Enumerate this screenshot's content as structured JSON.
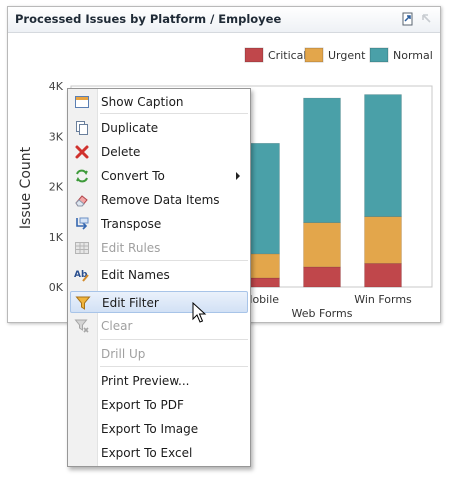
{
  "panel": {
    "title": "Processed Issues by Platform / Employee"
  },
  "chart_data": {
    "type": "bar",
    "stacked": true,
    "legend": {
      "position": "top-right",
      "entries": [
        "Critical",
        "Urgent",
        "Normal"
      ]
    },
    "colors": {
      "Critical": "#c0474b",
      "Urgent": "#e3a64b",
      "Normal": "#4aa0a8"
    },
    "ylabel": "Issue Count",
    "yticks": [
      "0K",
      "1K",
      "2K",
      "3K",
      "4K"
    ],
    "ylim": [
      0,
      4000
    ],
    "xticks": [
      "Mobile",
      "Win Forms"
    ],
    "xgroup": "Web Forms",
    "categories": [
      "",
      "",
      "Mobile",
      "",
      "Win Forms"
    ],
    "series": [
      {
        "name": "Critical",
        "values": [
          null,
          null,
          180,
          400,
          470
        ]
      },
      {
        "name": "Urgent",
        "values": [
          null,
          null,
          480,
          880,
          930
        ]
      },
      {
        "name": "Normal",
        "values": [
          null,
          null,
          2200,
          2480,
          2430
        ]
      }
    ]
  },
  "menu": {
    "items": [
      {
        "label": "Show Caption",
        "icon": "caption-icon",
        "disabled": false
      },
      {
        "label": "Duplicate",
        "icon": "duplicate-icon",
        "disabled": false
      },
      {
        "label": "Delete",
        "icon": "delete-icon",
        "disabled": false
      },
      {
        "label": "Convert To",
        "icon": "convert-icon",
        "disabled": false,
        "submenu": true
      },
      {
        "label": "Remove Data Items",
        "icon": "eraser-icon",
        "disabled": false
      },
      {
        "label": "Transpose",
        "icon": "transpose-icon",
        "disabled": false
      },
      {
        "label": "Edit Rules",
        "icon": "grid-icon",
        "disabled": true
      },
      {
        "label": "Edit Names",
        "icon": "rename-icon",
        "disabled": false
      },
      {
        "label": "Edit Filter",
        "icon": "filter-icon",
        "disabled": false,
        "highlight": true
      },
      {
        "label": "Clear",
        "icon": "clear-filter-icon",
        "disabled": true
      },
      {
        "label": "Drill Up",
        "disabled": true
      },
      {
        "label": "Print Preview...",
        "disabled": false
      },
      {
        "label": "Export To PDF",
        "disabled": false
      },
      {
        "label": "Export To Image",
        "disabled": false
      },
      {
        "label": "Export To Excel",
        "disabled": false
      }
    ]
  }
}
